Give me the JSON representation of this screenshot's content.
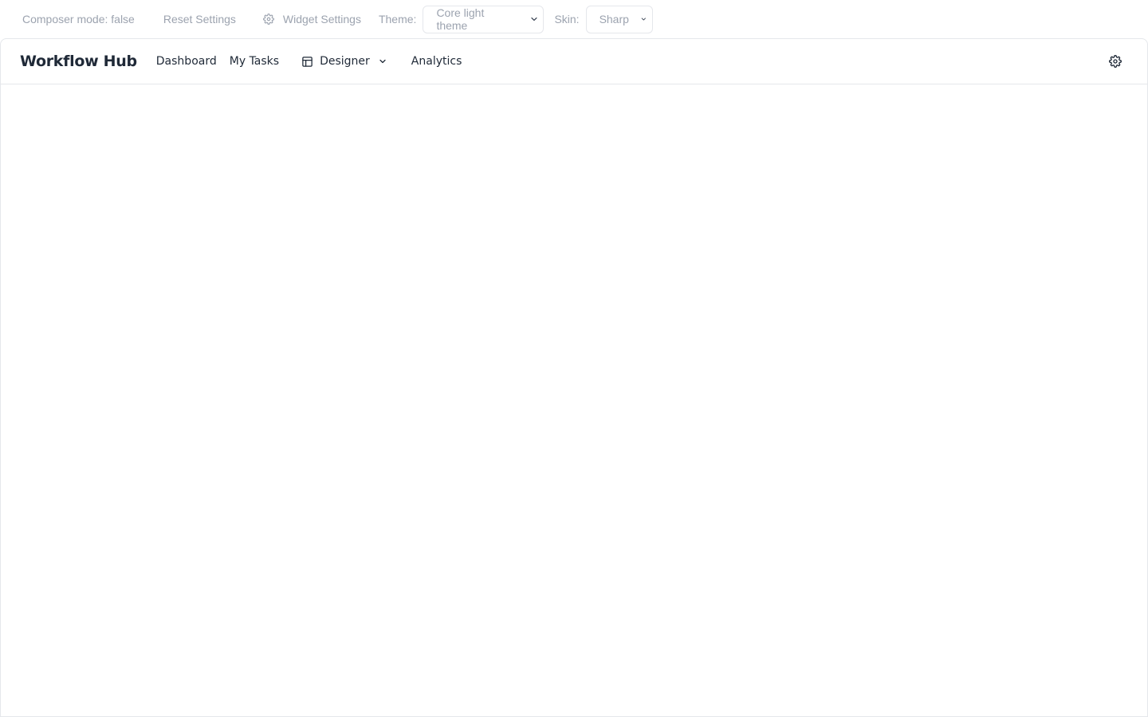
{
  "controls": {
    "composer_mode": "Composer mode: false",
    "reset_label": "Reset Settings",
    "widget_settings_label": "Widget Settings",
    "theme_label": "Theme:",
    "theme_value": "Core light theme",
    "skin_label": "Skin:",
    "skin_value": "Sharp"
  },
  "header": {
    "brand": "Workflow Hub",
    "nav": {
      "dashboard": "Dashboard",
      "my_tasks": "My Tasks",
      "designer": "Designer",
      "analytics": "Analytics"
    }
  },
  "icons": {
    "widget_settings": "gear-icon",
    "designer": "layout-icon",
    "designer_dropdown": "chevron-down-icon",
    "header_settings": "gear-icon"
  },
  "colors": {
    "text_primary": "#1f2937",
    "text_muted": "#9ca3af",
    "border": "#e5e7eb",
    "background": "#ffffff"
  }
}
